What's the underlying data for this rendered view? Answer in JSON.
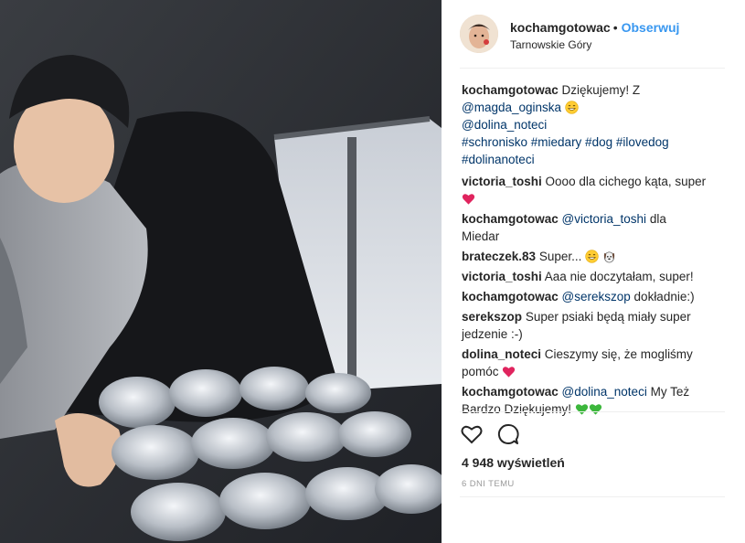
{
  "post": {
    "username": "kochamgotowac",
    "separator": "•",
    "follow_label": "Obserwuj",
    "location": "Tarnowskie Góry"
  },
  "caption": {
    "user": "kochamgotowac",
    "text_before": "Dziękujemy! Z",
    "mention1": "@magda_oginska",
    "mention2": "@dolina_noteci",
    "hashtags_line1": "#schronisko #miedary #dog #ilovedog",
    "hashtags_line2": "#dolinanoteci"
  },
  "comments": [
    {
      "user": "victoria_toshi",
      "text": "Oooo dla cichego kąta, super",
      "emoji": "red-heart-icon"
    },
    {
      "user": "kochamgotowac",
      "mention": "@victoria_toshi",
      "text": "dla Miedar"
    },
    {
      "user": "brateczek.83",
      "text": "Super...",
      "emoji": "grin-face-icon, dog-face-icon"
    },
    {
      "user": "victoria_toshi",
      "text": "Aaa nie doczytałam, super!"
    },
    {
      "user": "kochamgotowac",
      "mention": "@serekszop",
      "text": "dokładnie:)"
    },
    {
      "user": "serekszop",
      "text": "Super psiaki będą miały super jedzenie :-)"
    },
    {
      "user": "dolina_noteci",
      "text": "Cieszymy się, że mogliśmy pomóc",
      "emoji": "red-heart-icon"
    },
    {
      "user": "kochamgotowac",
      "mention": "@dolina_noteci",
      "text": "My Też Bardzo Dziękujemy!",
      "emoji": "green-heart-icon, green-heart-icon"
    }
  ],
  "stats": {
    "views": "4 948 wyświetleń",
    "time": "6 DNI TEMU"
  },
  "icons": {
    "like": "heart-outline-icon",
    "comment": "comment-bubble-icon"
  },
  "colors": {
    "link": "#003569",
    "follow": "#3897f0",
    "heart_red": "#ed4956",
    "heart_green": "#3cb73c"
  }
}
